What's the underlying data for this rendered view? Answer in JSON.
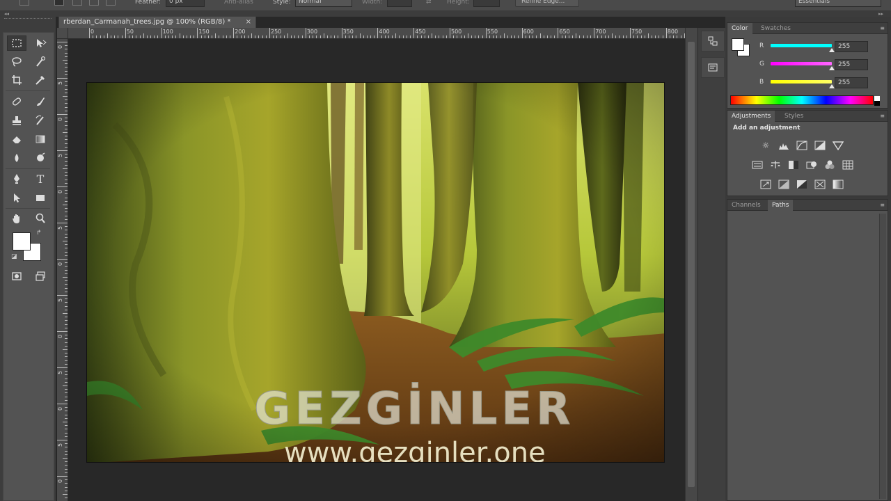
{
  "options_bar": {
    "feather_label": "Feather:",
    "feather_value": "0 px",
    "anti_alias_label": "Anti-alias",
    "style_label": "Style:",
    "style_value": "Normal",
    "width_label": "Width:",
    "height_label": "Height:",
    "refine_edge_label": "Refine Edge...",
    "workspace_value": "Essentials"
  },
  "document": {
    "tab_title": "rberdan_Carmanah_trees.jpg @ 100% (RGB/8) *",
    "close_glyph": "×"
  },
  "rulers": {
    "horizontal": [
      "0",
      "50",
      "100",
      "150",
      "200",
      "250",
      "300",
      "350",
      "400",
      "450",
      "500",
      "550",
      "600",
      "650",
      "700",
      "750",
      "800"
    ],
    "vertical": [
      "0",
      "5",
      "0",
      "5",
      "0",
      "5",
      "0",
      "5",
      "0",
      "5",
      "0",
      "5",
      "0"
    ]
  },
  "toolbar": {
    "foreground_color": "#ffffff",
    "background_color": "#ffffff",
    "text_tool_glyph": "T"
  },
  "image": {
    "watermark_logo_text": "GEZGİNLER",
    "watermark_url": "www.gezginler.one"
  },
  "color_panel": {
    "tabs": [
      "Color",
      "Swatches"
    ],
    "channels": [
      {
        "label": "R",
        "value": "255",
        "gradient": [
          "#000000",
          "#00ffff"
        ]
      },
      {
        "label": "G",
        "value": "255",
        "gradient": [
          "#ff00ff",
          "#ffffff"
        ]
      },
      {
        "label": "B",
        "value": "255",
        "gradient": [
          "#ffff00",
          "#ffffff"
        ]
      }
    ]
  },
  "adjustments_panel": {
    "tabs": [
      "Adjustments",
      "Styles"
    ],
    "title": "Add an adjustment",
    "icons": [
      [
        "brightness-contrast-icon",
        "levels-icon",
        "curves-icon",
        "exposure-icon",
        "vibrance-icon"
      ],
      [
        "hue-saturation-icon",
        "color-balance-icon",
        "black-white-icon",
        "photo-filter-icon",
        "channel-mixer-icon",
        "color-lookup-icon"
      ],
      [
        "invert-icon",
        "posterize-icon",
        "threshold-icon",
        "selective-color-icon",
        "gradient-map-icon"
      ]
    ]
  },
  "channels_panel": {
    "tabs": [
      "Channels",
      "Paths"
    ]
  }
}
